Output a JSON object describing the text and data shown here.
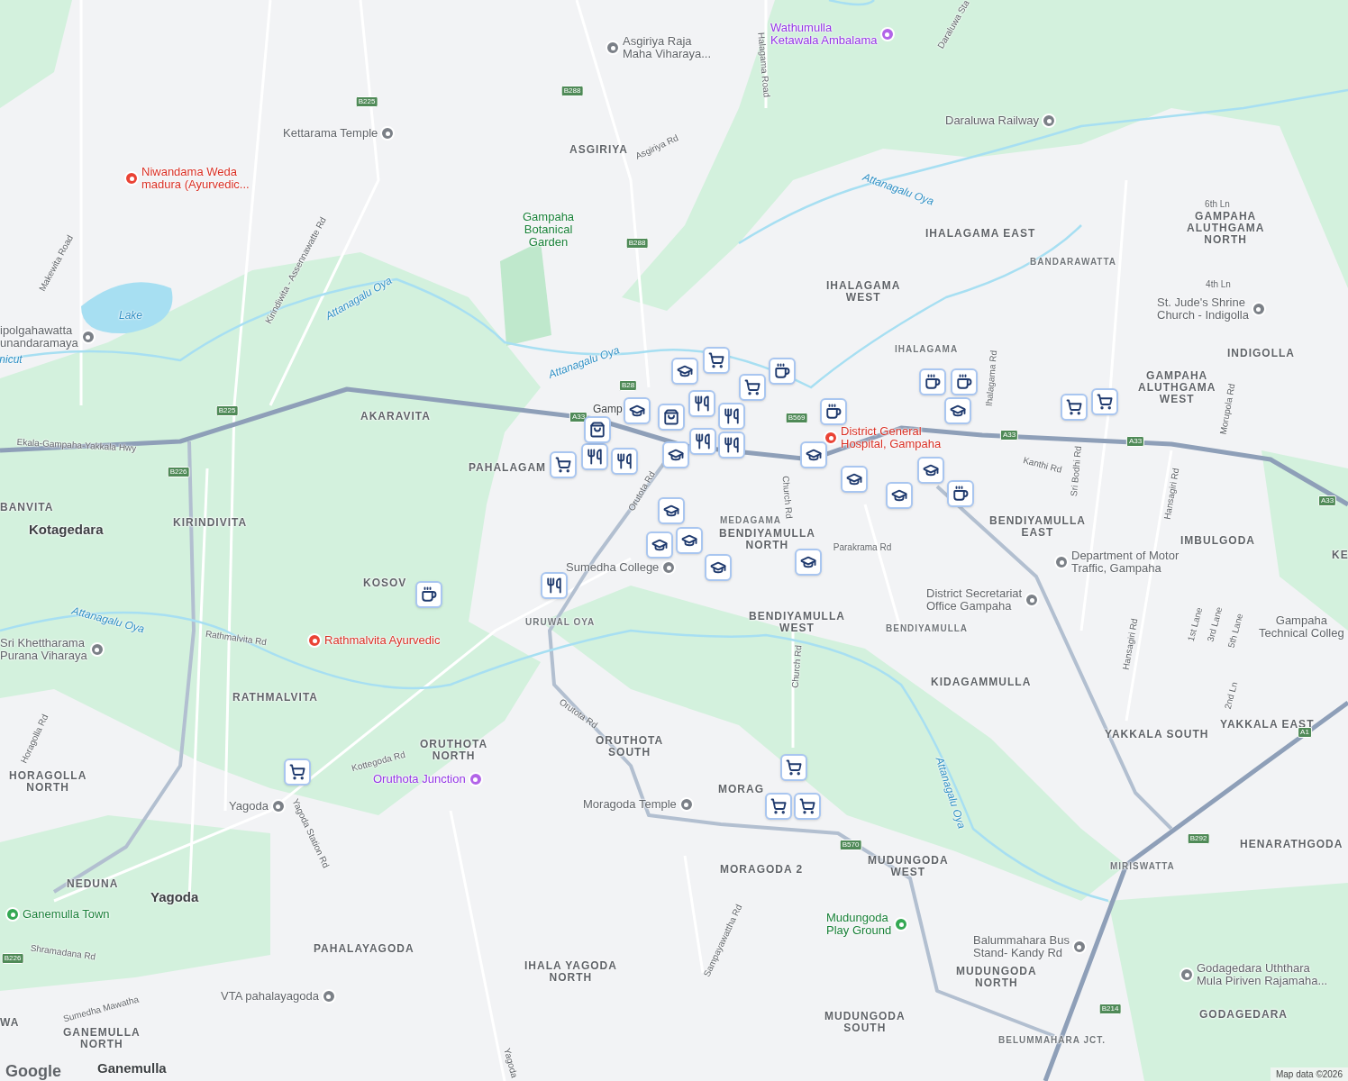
{
  "places": [
    {
      "text": "Asgiriya Raja\nMaha Viharaya...",
      "kind": "grey"
    },
    {
      "text": "Wathumulla\nKetawala Ambalama",
      "kind": "purple"
    },
    {
      "text": "Kettarama Temple",
      "kind": "grey"
    },
    {
      "text": "Niwandama Weda\nmadura (Ayurvedic...",
      "kind": "red"
    },
    {
      "text": "Daraluwa Railway",
      "kind": "grey"
    },
    {
      "text": "Gampaha\nBotanical\nGarden",
      "kind": "green"
    },
    {
      "text": "ipolgahawatta\nunandaramaya",
      "kind": "grey"
    },
    {
      "text": "St. Jude's Shrine\nChurch - Indigolla",
      "kind": "grey"
    },
    {
      "text": "District General\nHospital, Gampaha",
      "kind": "red"
    },
    {
      "text": "Department of Motor\nTraffic, Gampaha",
      "kind": "grey"
    },
    {
      "text": "District Secretariat\nOffice Gampaha",
      "kind": "grey"
    },
    {
      "text": "Sumedha College",
      "kind": "grey"
    },
    {
      "text": "Sri Khettharama\nPurana Viharaya",
      "kind": "grey"
    },
    {
      "text": "Rathmalvita Ayurvedic",
      "kind": "red"
    },
    {
      "text": "Oruthota Junction",
      "kind": "purple"
    },
    {
      "text": "Moragoda Temple",
      "kind": "grey"
    },
    {
      "text": "Mudungoda\nPlay Ground",
      "kind": "green"
    },
    {
      "text": "Balummahara Bus\nStand- Kandy Rd",
      "kind": "grey"
    },
    {
      "text": "Godagedara Uththara\nMula Piriven Rajamaha...",
      "kind": "grey"
    },
    {
      "text": "VTA pahalayagoda",
      "kind": "grey"
    },
    {
      "text": "Ganemulla Town",
      "kind": "green"
    },
    {
      "text": "Yagoda",
      "kind": "grey"
    },
    {
      "text": "Gampaha\nTechnical Colleg",
      "kind": "grey"
    }
  ],
  "areas": [
    {
      "text": "ASGIRIYA",
      "kind": "area"
    },
    {
      "text": "AKARAVITA",
      "kind": "area"
    },
    {
      "text": "PAHALAGAM",
      "kind": "area"
    },
    {
      "text": "KIRINDIVITA",
      "kind": "area"
    },
    {
      "text": "KOSOV",
      "kind": "area"
    },
    {
      "text": "URUWAL OYA",
      "kind": "small"
    },
    {
      "text": "RATHMALVITA",
      "kind": "area"
    },
    {
      "text": "ORUTHOTA\nNORTH",
      "kind": "area"
    },
    {
      "text": "ORUTHOTA\nSOUTH",
      "kind": "area"
    },
    {
      "text": "HORAGOLLA\nNORTH",
      "kind": "area"
    },
    {
      "text": "NEDUNA",
      "kind": "area"
    },
    {
      "text": "PAHALAYAGODA",
      "kind": "area"
    },
    {
      "text": "IHALA YAGODA\nNORTH",
      "kind": "area"
    },
    {
      "text": "GANEMULLA\nNORTH",
      "kind": "area"
    },
    {
      "text": "MORAGODA 2",
      "kind": "area"
    },
    {
      "text": "MUDUNGODA\nWEST",
      "kind": "area"
    },
    {
      "text": "MUDUNGODA\nNORTH",
      "kind": "area"
    },
    {
      "text": "MUDUNGODA\nSOUTH",
      "kind": "area"
    },
    {
      "text": "MEDAGAMA",
      "kind": "small"
    },
    {
      "text": "BENDIYAMULLA\nNORTH",
      "kind": "area"
    },
    {
      "text": "BENDIYAMULLA\nWEST",
      "kind": "area"
    },
    {
      "text": "BENDIYAMULLA",
      "kind": "small"
    },
    {
      "text": "KIDAGAMMULLA",
      "kind": "area"
    },
    {
      "text": "YAKKALA SOUTH",
      "kind": "area"
    },
    {
      "text": "YAKKALA EAST",
      "kind": "area"
    },
    {
      "text": "HENARATHGODA",
      "kind": "area"
    },
    {
      "text": "MIRISWATTA",
      "kind": "small"
    },
    {
      "text": "GODAGEDARA",
      "kind": "area"
    },
    {
      "text": "BELUMMAHARA JCT.",
      "kind": "small"
    },
    {
      "text": "IMBULGODA",
      "kind": "area"
    },
    {
      "text": "BENDIYAMULLA\nEAST",
      "kind": "area"
    },
    {
      "text": "INDIGOLLA",
      "kind": "area"
    },
    {
      "text": "GAMPAHA\nALUTHGAMA\nWEST",
      "kind": "area"
    },
    {
      "text": "GAMPAHA\nALUTHGAMA\nNORTH",
      "kind": "area"
    },
    {
      "text": "BANDARAWATTA",
      "kind": "small"
    },
    {
      "text": "IHALAGAMA EAST",
      "kind": "area"
    },
    {
      "text": "IHALAGAMA\nWEST",
      "kind": "area"
    },
    {
      "text": "IHALAGAMA",
      "kind": "small"
    },
    {
      "text": "BANVITA",
      "kind": "area"
    },
    {
      "text": "KE",
      "kind": "area"
    },
    {
      "text": "MORAG",
      "kind": "area"
    },
    {
      "text": "WA",
      "kind": "area"
    }
  ],
  "towns": [
    "Kotagedara",
    "Yagoda",
    "Ganemulla",
    "Gamp"
  ],
  "water": [
    "Lake",
    "nicut",
    "Attanagalu Oya",
    "Attanagalu Oya",
    "Attanagalu Oya",
    "Attanagalu Oya",
    "Attanagalu Oya"
  ],
  "roads": [
    "Kirindiwita - Assennawatte Rd",
    "Makewita Road",
    "Halagama Road",
    "Asgiriya Rd",
    "Ekala-Gampaha-Yakkala Hwy",
    "Rathmalvita Rd",
    "Orutota Rd",
    "Orutota Rd",
    "Church Rd",
    "Church Rd",
    "Parakrama Rd",
    "Kanthi Rd",
    "Sri Bodhi Rd",
    "Hansagiri Rd",
    "Hansagiri Rd",
    "Morupola Rd",
    "Kottegoda Rd",
    "Yagoda Station Rd",
    "Shramadana Rd",
    "Sumedha Mawatha",
    "Sampayawattha Rd",
    "Horagolla Rd",
    "Ihalagama Rd",
    "Daraluwa Sta",
    "6th Ln",
    "4th Ln",
    "1st Lane",
    "3rd Lane",
    "5th Lane",
    "2nd Ln",
    "Yagoda"
  ],
  "badges": [
    "B225",
    "B288",
    "B288",
    "B225",
    "B226",
    "A33",
    "B569",
    "A33",
    "A33",
    "A33",
    "B570",
    "B292",
    "A1",
    "B214",
    "B226",
    "B28"
  ],
  "map_data": "Map data ©2026",
  "logo": "Google"
}
